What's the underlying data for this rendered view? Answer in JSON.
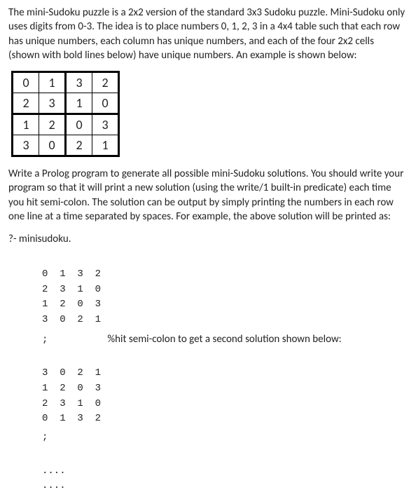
{
  "intro": "The mini-Sudoku puzzle is a 2x2 version of the standard 3x3 Sudoku puzzle. Mini-Sudoku only uses digits from 0-3. The idea is to place numbers 0, 1, 2, 3 in a 4x4 table such that each row has unique numbers, each column has unique numbers, and each of the four 2x2 cells (shown with bold lines below) have unique numbers. An example is shown below:",
  "table": {
    "r0c0": "0",
    "r0c1": "1",
    "r0c2": "3",
    "r0c3": "2",
    "r1c0": "2",
    "r1c1": "3",
    "r1c2": "1",
    "r1c3": "0",
    "r2c0": "1",
    "r2c1": "2",
    "r2c2": "0",
    "r2c3": "3",
    "r3c0": "3",
    "r3c1": "0",
    "r3c2": "2",
    "r3c3": "1"
  },
  "instructions": "Write a Prolog program to generate all possible mini-Sudoku solutions. You should write your program so that it will print a new solution (using the write/1 built-in predicate) each time you hit semi-colon. The solution can be output by simply printing the numbers in each row one line at a time separated by spaces. For example, the above solution will be printed as:",
  "query": "?- minisudoku.",
  "solution1": {
    "row0": "0  1  3  2",
    "row1": "2  3  1  0",
    "row2": "1  2  0  3",
    "row3": "3  0  2  1"
  },
  "semicolon": ";",
  "comment": "%hit semi-colon to get a second solution shown below:",
  "solution2": {
    "row0": "3  0  2  1",
    "row1": "1  2  0  3",
    "row2": "2  3  1  0",
    "row3": "0  1  3  2"
  },
  "ellipsis1": "....",
  "ellipsis2": "...."
}
